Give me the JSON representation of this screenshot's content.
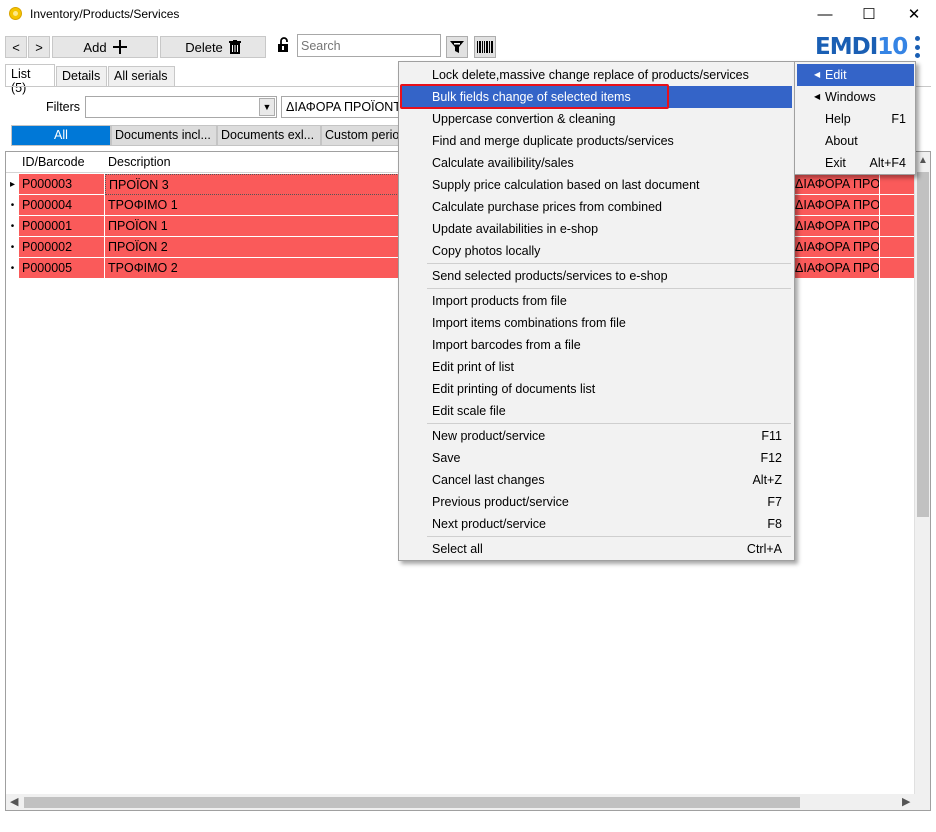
{
  "window": {
    "title": "Inventory/Products/Services",
    "minimize": "—",
    "maximize": "☐",
    "close": "✕"
  },
  "toolbar": {
    "back": "<",
    "forward": ">",
    "add_label": "Add",
    "delete_label": "Delete",
    "search_placeholder": "Search",
    "logo_main": "EMDI",
    "logo_num": "10"
  },
  "tabs": [
    {
      "label": "List (5)"
    },
    {
      "label": "Details"
    },
    {
      "label": "All serials"
    }
  ],
  "filters": {
    "label": "Filters",
    "combo_value": "",
    "value": "ΔΙΑΦΟΡΑ ΠΡΟΪΟΝΤΑ"
  },
  "segments": [
    {
      "label": "All"
    },
    {
      "label": "Documents incl..."
    },
    {
      "label": "Documents exl..."
    },
    {
      "label": "Custom period"
    }
  ],
  "grid": {
    "columns": [
      "ID/Barcode",
      "Description"
    ],
    "rows": [
      {
        "marker": "▸",
        "id": "P000003",
        "desc": "ΠΡΟΪΟΝ 3",
        "right": "ΔΙΑΦΟΡΑ ΠΡΟ"
      },
      {
        "marker": "•",
        "id": "P000004",
        "desc": "ΤΡΟΦΙΜΟ 1",
        "right": "ΔΙΑΦΟΡΑ ΠΡΟ"
      },
      {
        "marker": "•",
        "id": "P000001",
        "desc": "ΠΡΟΪΟΝ 1",
        "right": "ΔΙΑΦΟΡΑ ΠΡΟ"
      },
      {
        "marker": "•",
        "id": "P000002",
        "desc": "ΠΡΟΪΟΝ 2",
        "right": "ΔΙΑΦΟΡΑ ΠΡΟ"
      },
      {
        "marker": "•",
        "id": "P000005",
        "desc": "ΤΡΟΦΙΜΟ 2",
        "right": "ΔΙΑΦΟΡΑ ΠΡΟ"
      }
    ]
  },
  "context_menu": {
    "items": [
      {
        "label": "Lock delete,massive change  replace of products/services",
        "shortcut": ""
      },
      {
        "label": "Bulk fields change of selected items",
        "shortcut": "",
        "highlighted": true
      },
      {
        "label": "Uppercase convertion & cleaning",
        "shortcut": ""
      },
      {
        "label": "Find and merge duplicate products/services",
        "shortcut": ""
      },
      {
        "label": "Calculate availibility/sales",
        "shortcut": ""
      },
      {
        "label": "Supply price calculation based on last document",
        "shortcut": ""
      },
      {
        "label": "Calculate purchase prices from combined",
        "shortcut": ""
      },
      {
        "label": "Update availabilities in e-shop",
        "shortcut": ""
      },
      {
        "label": "Copy photos locally",
        "shortcut": ""
      },
      {
        "label": "Send selected products/services to e-shop",
        "shortcut": ""
      },
      {
        "label": "Import products from file",
        "shortcut": ""
      },
      {
        "label": "Import items combinations from file",
        "shortcut": ""
      },
      {
        "label": "Import barcodes from a file",
        "shortcut": ""
      },
      {
        "label": "Edit print of list",
        "shortcut": ""
      },
      {
        "label": "Edit printing of documents list",
        "shortcut": ""
      },
      {
        "label": "Edit scale file",
        "shortcut": ""
      },
      {
        "label": "New product/service",
        "shortcut": "F11"
      },
      {
        "label": "Save",
        "shortcut": "F12"
      },
      {
        "label": "Cancel last changes",
        "shortcut": "Alt+Z"
      },
      {
        "label": "Previous product/service",
        "shortcut": "F7"
      },
      {
        "label": "Next product/service",
        "shortcut": "F8"
      },
      {
        "label": "Select all",
        "shortcut": "Ctrl+A"
      }
    ]
  },
  "main_menu": {
    "items": [
      {
        "label": "Edit",
        "shortcut": "",
        "submenu": true,
        "highlighted": true
      },
      {
        "label": "Windows",
        "shortcut": "",
        "submenu": true
      },
      {
        "label": "Help",
        "shortcut": "F1"
      },
      {
        "label": "About",
        "shortcut": ""
      },
      {
        "label": "Exit",
        "shortcut": "Alt+F4"
      }
    ]
  }
}
